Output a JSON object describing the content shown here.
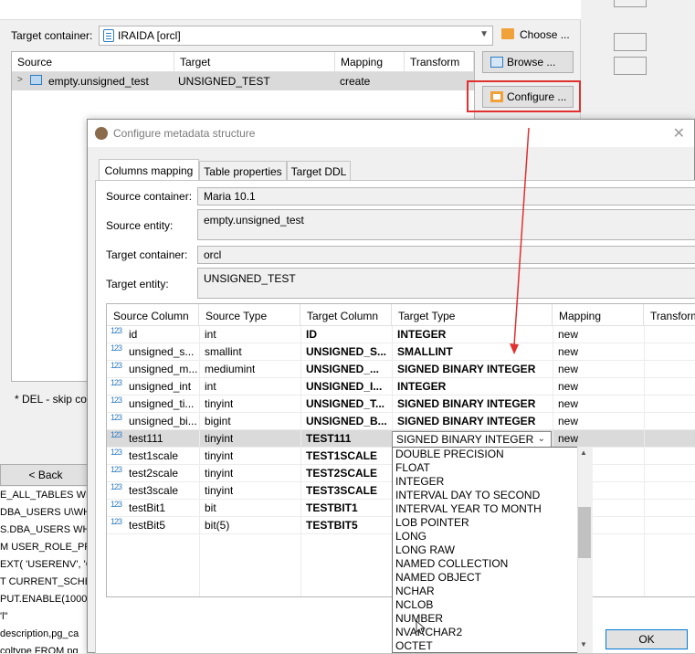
{
  "background": {
    "target_container_label": "Target container:",
    "target_container_value": "IRAIDA  [orcl]",
    "choose_button": "Choose ...",
    "browse_button": "Browse ...",
    "configure_button": "Configure ...",
    "table_headers": [
      "Source",
      "Target",
      "Mapping",
      "Transform"
    ],
    "table_row": {
      "source": "empty.unsigned_test",
      "target": "UNSIGNED_TEST",
      "mapping": "create",
      "transform": ""
    },
    "del_note": "* DEL - skip col",
    "back_button": "< Back",
    "console_lines": [
      "E_ALL_TABLES WH",
      "DBA_USERS U\\WH",
      "S.DBA_USERS WH",
      "M USER_ROLE_PRIV",
      "EXT( 'USERENV', 'C",
      "T CURRENT_SCHE",
      "PUT.ENABLE(1000",
      "'l\"",
      "description,pg_ca",
      "coltype FROM pg_"
    ]
  },
  "dialog": {
    "title": "Configure metadata structure",
    "tabs": [
      "Columns mapping",
      "Table properties",
      "Target DDL"
    ],
    "source_container_label": "Source container:",
    "source_container_value": "Maria 10.1",
    "source_entity_label": "Source entity:",
    "source_entity_value": "empty.unsigned_test",
    "target_container_label": "Target container:",
    "target_container_value": "orcl",
    "target_entity_label": "Target entity:",
    "target_entity_value": "UNSIGNED_TEST",
    "columns": [
      "Source Column",
      "Source Type",
      "Target Column",
      "Target Type",
      "Mapping",
      "Transform"
    ],
    "rows": [
      {
        "icon": "123",
        "source": "id",
        "stype": "int",
        "target": "ID",
        "ttype": "INTEGER",
        "mapping": "new"
      },
      {
        "icon": "123",
        "source": "unsigned_s...",
        "stype": "smallint",
        "target": "UNSIGNED_S...",
        "ttype": "SMALLINT",
        "mapping": "new"
      },
      {
        "icon": "123",
        "source": "unsigned_m...",
        "stype": "mediumint",
        "target": "UNSIGNED_...",
        "ttype": "SIGNED BINARY INTEGER",
        "mapping": "new"
      },
      {
        "icon": "123",
        "source": "unsigned_int",
        "stype": "int",
        "target": "UNSIGNED_I...",
        "ttype": "INTEGER",
        "mapping": "new"
      },
      {
        "icon": "123",
        "source": "unsigned_ti...",
        "stype": "tinyint",
        "target": "UNSIGNED_T...",
        "ttype": "SIGNED BINARY INTEGER",
        "mapping": "new"
      },
      {
        "icon": "123",
        "source": "unsigned_bi...",
        "stype": "bigint",
        "target": "UNSIGNED_B...",
        "ttype": "SIGNED BINARY INTEGER",
        "mapping": "new"
      },
      {
        "icon": "123",
        "source": "test111",
        "stype": "tinyint",
        "target": "TEST111",
        "ttype": "SIGNED BINARY INTEGER",
        "mapping": "new"
      },
      {
        "icon": "123",
        "source": "test1scale",
        "stype": "tinyint",
        "target": "TEST1SCALE",
        "ttype": "",
        "mapping": ""
      },
      {
        "icon": "123",
        "source": "test2scale",
        "stype": "tinyint",
        "target": "TEST2SCALE",
        "ttype": "",
        "mapping": ""
      },
      {
        "icon": "123",
        "source": "test3scale",
        "stype": "tinyint",
        "target": "TEST3SCALE",
        "ttype": "",
        "mapping": ""
      },
      {
        "icon": "123",
        "source": "testBit1",
        "stype": "bit",
        "target": "TESTBIT1",
        "ttype": "",
        "mapping": ""
      },
      {
        "icon": "123",
        "source": "testBit5",
        "stype": "bit(5)",
        "target": "TESTBIT5",
        "ttype": "",
        "mapping": ""
      }
    ],
    "selected_type": "SIGNED BINARY INTEGER",
    "dropdown_options": [
      "DOUBLE PRECISION",
      "FLOAT",
      "INTEGER",
      "INTERVAL DAY TO SECOND",
      "INTERVAL YEAR TO MONTH",
      "LOB POINTER",
      "LONG",
      "LONG RAW",
      "NAMED COLLECTION",
      "NAMED OBJECT",
      "NCHAR",
      "NCLOB",
      "NUMBER",
      "NVARCHAR2",
      "OCTET"
    ],
    "ok_button": "OK"
  },
  "colors": {
    "highlight": "#e03030",
    "arrow": "#e03030",
    "selection": "#dadada",
    "accent": "#0078d7"
  }
}
